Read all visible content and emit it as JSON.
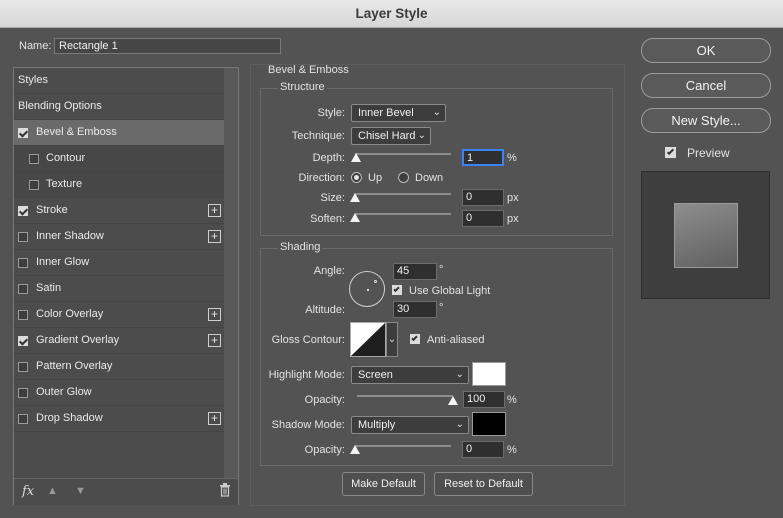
{
  "window": {
    "title": "Layer Style"
  },
  "name_field": {
    "label": "Name:",
    "value": "Rectangle 1"
  },
  "styles_list": {
    "items": [
      {
        "label": "Styles",
        "checkbox": null,
        "plus": false
      },
      {
        "label": "Blending Options",
        "checkbox": null,
        "plus": false
      },
      {
        "label": "Bevel & Emboss",
        "checkbox": true,
        "plus": false,
        "selected": true
      },
      {
        "label": "Contour",
        "checkbox": false,
        "plus": false,
        "sub": true
      },
      {
        "label": "Texture",
        "checkbox": false,
        "plus": false,
        "sub": true
      },
      {
        "label": "Stroke",
        "checkbox": true,
        "plus": true
      },
      {
        "label": "Inner Shadow",
        "checkbox": false,
        "plus": true
      },
      {
        "label": "Inner Glow",
        "checkbox": false,
        "plus": false
      },
      {
        "label": "Satin",
        "checkbox": false,
        "plus": false
      },
      {
        "label": "Color Overlay",
        "checkbox": false,
        "plus": true
      },
      {
        "label": "Gradient Overlay",
        "checkbox": true,
        "plus": true
      },
      {
        "label": "Pattern Overlay",
        "checkbox": false,
        "plus": false
      },
      {
        "label": "Outer Glow",
        "checkbox": false,
        "plus": false
      },
      {
        "label": "Drop Shadow",
        "checkbox": false,
        "plus": true
      }
    ],
    "footer": {
      "fx": "fx",
      "plus_sign": "+"
    }
  },
  "bevel": {
    "heading": "Bevel & Emboss",
    "structure": {
      "heading": "Structure",
      "style_label": "Style:",
      "style_value": "Inner Bevel",
      "technique_label": "Technique:",
      "technique_value": "Chisel Hard",
      "depth_label": "Depth:",
      "depth_value": "1",
      "depth_unit": "%",
      "depth_level": 0.01,
      "direction_label": "Direction:",
      "direction_up": "Up",
      "direction_down": "Down",
      "direction_selected": "Up",
      "size_label": "Size:",
      "size_value": "0",
      "size_unit": "px",
      "soften_label": "Soften:",
      "soften_value": "0",
      "soften_unit": "px"
    },
    "shading": {
      "heading": "Shading",
      "angle_label": "Angle:",
      "angle_value": "45",
      "angle_unit": "°",
      "global_light_label": "Use Global Light",
      "global_light": true,
      "altitude_label": "Altitude:",
      "altitude_value": "30",
      "altitude_unit": "°",
      "gloss_label": "Gloss Contour:",
      "anti_aliased_label": "Anti-aliased",
      "anti_aliased": true,
      "highlight_mode_label": "Highlight Mode:",
      "highlight_mode_value": "Screen",
      "highlight_color": "#ffffff",
      "highlight_opacity_label": "Opacity:",
      "highlight_opacity_value": "100",
      "highlight_opacity_unit": "%",
      "highlight_opacity_level": 1.0,
      "shadow_mode_label": "Shadow Mode:",
      "shadow_mode_value": "Multiply",
      "shadow_color": "#000000",
      "shadow_opacity_label": "Opacity:",
      "shadow_opacity_value": "0",
      "shadow_opacity_unit": "%",
      "shadow_opacity_level": 0.0
    },
    "make_default": "Make Default",
    "reset_default": "Reset to Default"
  },
  "actions": {
    "ok": "OK",
    "cancel": "Cancel",
    "new_style": "New Style...",
    "preview_label": "Preview",
    "preview_checked": true
  }
}
